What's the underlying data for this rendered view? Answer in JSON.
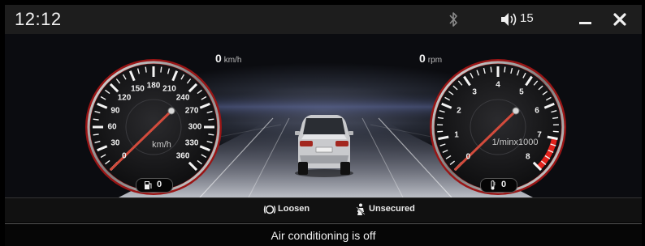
{
  "status_bar": {
    "time": "12:12",
    "bluetooth_icon": "bluetooth-icon",
    "volume_icon": "speaker-icon",
    "volume": "15",
    "minimize_icon": "minimize-icon",
    "close_icon": "close-icon"
  },
  "speedometer": {
    "readout_value": "0",
    "readout_unit": "km/h",
    "tick_labels": [
      "0",
      "30",
      "60",
      "90",
      "120",
      "150",
      "180",
      "210",
      "240",
      "270",
      "300",
      "330",
      "360"
    ],
    "unit_label": "km/h",
    "needle_value": 0,
    "fuel_icon": "fuel-pump-icon",
    "fuel_value": "0"
  },
  "tachometer": {
    "readout_value": "0",
    "readout_unit": "rpm",
    "tick_labels": [
      "0",
      "1",
      "2",
      "3",
      "4",
      "5",
      "6",
      "7",
      "8"
    ],
    "unit_label": "1/minx1000",
    "needle_value": 0,
    "redline_start": 7,
    "redline_color": "#e3221c",
    "temp_icon": "coolant-temperature-icon",
    "temp_value": "0"
  },
  "warnings": {
    "brake_icon": "parking-brake-icon",
    "brake_label": "Loosen",
    "seatbelt_icon": "seatbelt-icon",
    "seatbelt_label": "Unsecured"
  },
  "message": "Air conditioning is off",
  "colors": {
    "needle": "#d24b3c",
    "bezel": "#9a1515"
  }
}
